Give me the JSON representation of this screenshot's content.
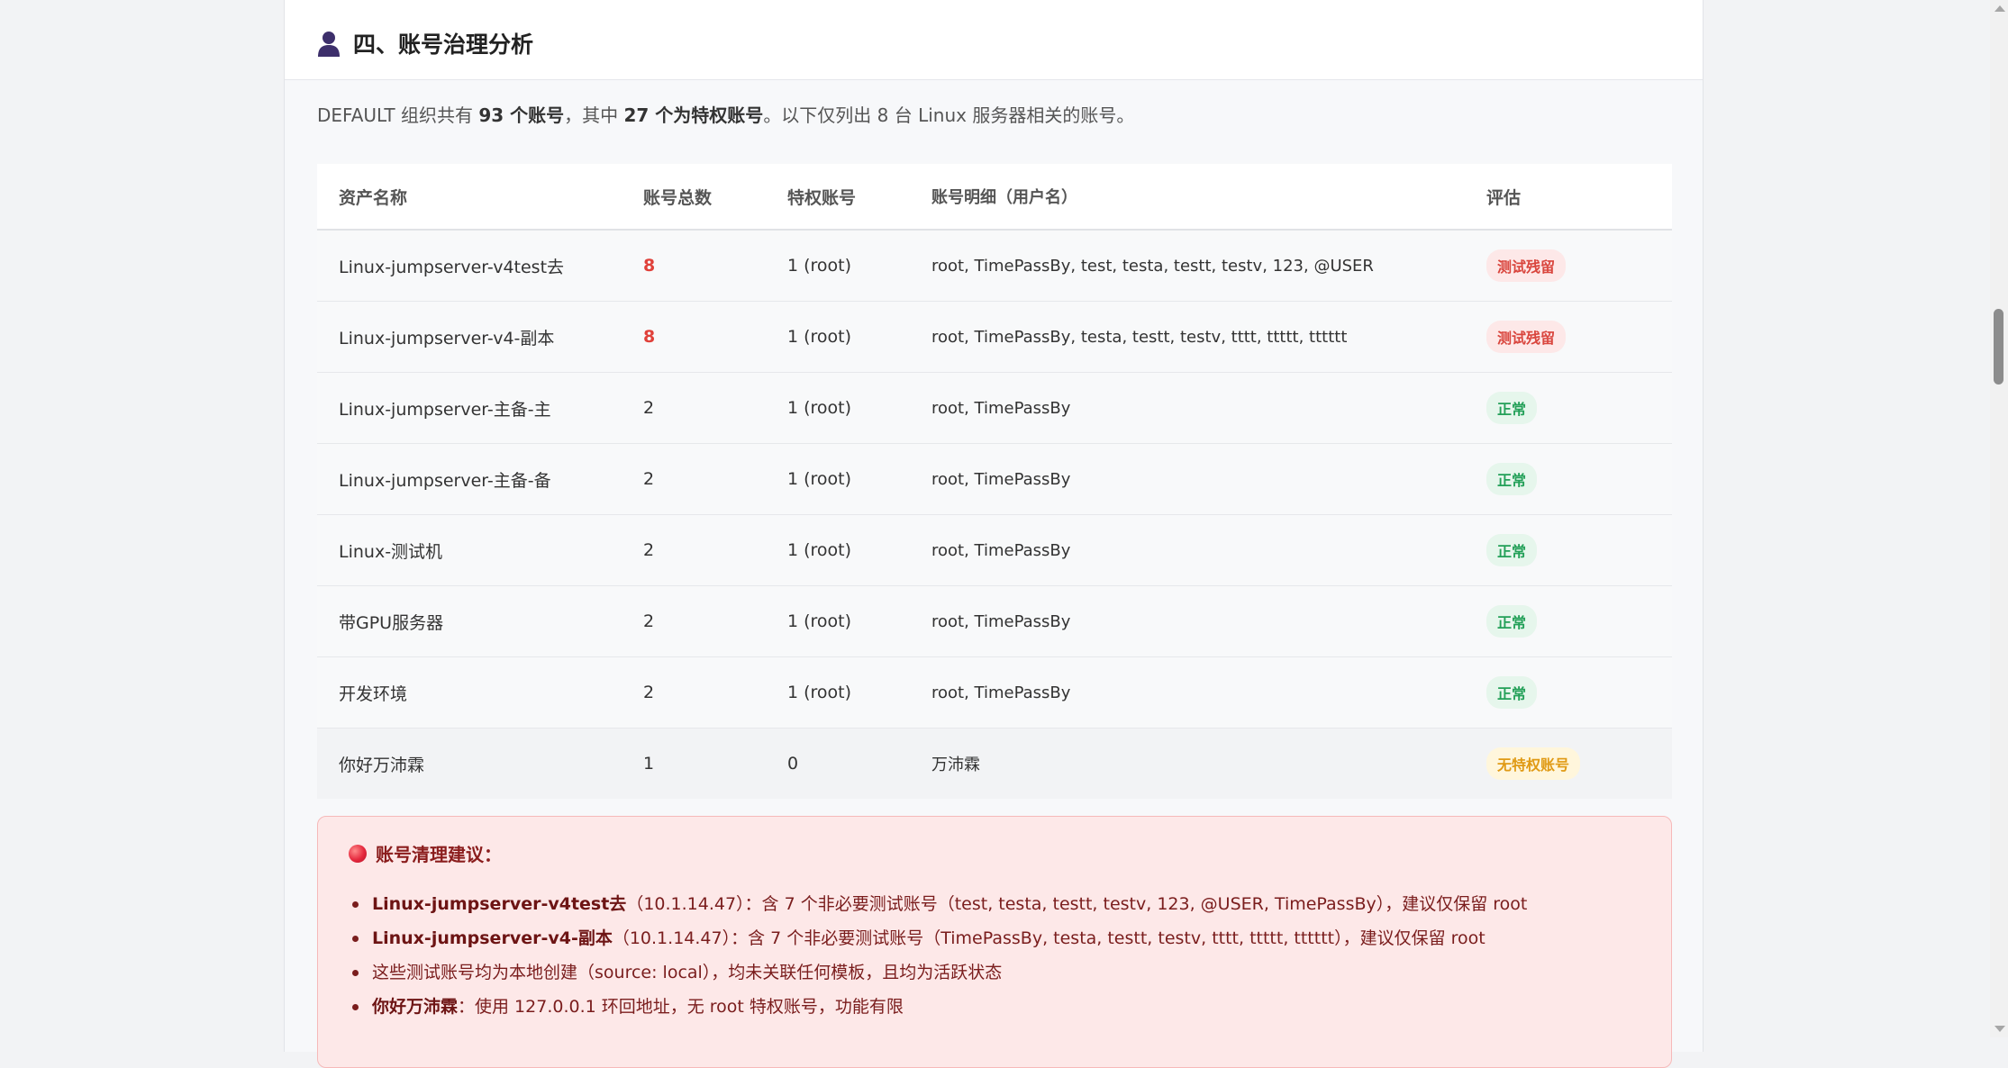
{
  "section": {
    "title": "四、账号治理分析",
    "icon": "person-icon"
  },
  "intro": {
    "prefix": "DEFAULT 组织共有 ",
    "total": "93 个账号",
    "mid": "，其中 ",
    "privileged": "27 个为特权账号",
    "suffix": "。以下仅列出 8 台 Linux 服务器相关的账号。"
  },
  "table": {
    "headers": [
      "资产名称",
      "账号总数",
      "特权账号",
      "账号明细（用户名）",
      "评估"
    ],
    "rows": [
      {
        "name": "Linux-jumpserver-v4test去",
        "count": "8",
        "priv": "1 (root)",
        "detail": "root, TimePassBy, test, testa, testt, testv, 123, @USER",
        "assessment": "测试残留"
      },
      {
        "name": "Linux-jumpserver-v4-副本",
        "count": "8",
        "priv": "1 (root)",
        "detail": "root, TimePassBy, testa, testt, testv, tttt, ttttt, tttttt",
        "assessment": "测试残留"
      },
      {
        "name": "Linux-jumpserver-主备-主",
        "count": "2",
        "priv": "1 (root)",
        "detail": "root, TimePassBy",
        "assessment": "正常"
      },
      {
        "name": "Linux-jumpserver-主备-备",
        "count": "2",
        "priv": "1 (root)",
        "detail": "root, TimePassBy",
        "assessment": "正常"
      },
      {
        "name": "Linux-测试机",
        "count": "2",
        "priv": "1 (root)",
        "detail": "root, TimePassBy",
        "assessment": "正常"
      },
      {
        "name": "带GPU服务器",
        "count": "2",
        "priv": "1 (root)",
        "detail": "root, TimePassBy",
        "assessment": "正常"
      },
      {
        "name": "开发环境",
        "count": "2",
        "priv": "1 (root)",
        "detail": "root, TimePassBy",
        "assessment": "正常"
      },
      {
        "name": "你好万沛霖",
        "count": "1",
        "priv": "0",
        "detail": "万沛霖",
        "assessment": "无特权账号"
      }
    ]
  },
  "advice": {
    "title": "账号清理建议：",
    "icon": "red-circle-icon",
    "items": [
      {
        "bold": "Linux-jumpserver-v4test去",
        "text": "（10.1.14.47）：含 7 个非必要测试账号（test, testa, testt, testv, 123, @USER, TimePassBy），建议仅保留 root"
      },
      {
        "bold": "Linux-jumpserver-v4-副本",
        "text": "（10.1.14.47）：含 7 个非必要测试账号（TimePassBy, testa, testt, testv, tttt, ttttt, tttttt），建议仅保留 root"
      },
      {
        "bold": "",
        "text": "这些测试账号均为本地创建（source: local），均未关联任何模板，且均为活跃状态"
      },
      {
        "bold": "你好万沛霖",
        "text": "：使用 127.0.0.1 环回地址，无 root 特权账号，功能有限"
      }
    ]
  },
  "colors": {
    "danger": "#e0413a",
    "success": "#23a058",
    "warning": "#e09a14",
    "advice_bg": "#fde8e8"
  }
}
